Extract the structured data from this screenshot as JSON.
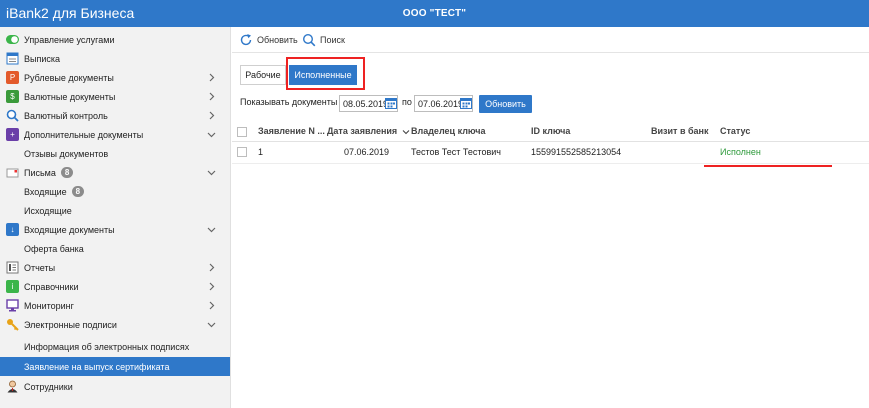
{
  "header": {
    "brand": "iBank2 для Бизнеса",
    "company": "ООО \"ТЕСТ\""
  },
  "colors": {
    "accent": "#2f78c9",
    "highlight": "#ee2222",
    "status_ok": "#2e9a3b"
  },
  "sidebar": {
    "items": [
      {
        "label": "Управление услугами",
        "icon": "toggle-icon"
      },
      {
        "label": "Выписка",
        "icon": "statement-icon"
      },
      {
        "label": "Рублевые документы",
        "icon": "ruble-doc-icon"
      },
      {
        "label": "Валютные документы",
        "icon": "currency-doc-icon"
      },
      {
        "label": "Валютный контроль",
        "icon": "magnifier-icon"
      },
      {
        "label": "Дополнительные документы",
        "icon": "additional-doc-icon"
      },
      {
        "label": "Отзывы документов"
      },
      {
        "label": "Письма",
        "icon": "letter-icon",
        "badge": "8"
      },
      {
        "label": "Входящие",
        "badge": "8"
      },
      {
        "label": "Исходящие"
      },
      {
        "label": "Входящие документы",
        "icon": "incoming-doc-icon"
      },
      {
        "label": "Оферта банка"
      },
      {
        "label": "Отчеты",
        "icon": "report-icon"
      },
      {
        "label": "Справочники",
        "icon": "reference-icon"
      },
      {
        "label": "Мониторинг",
        "icon": "monitor-icon"
      },
      {
        "label": "Электронные подписи",
        "icon": "key-icon"
      },
      {
        "label": "Информация об электронных подписях"
      },
      {
        "label": "Заявление на выпуск сертификата"
      },
      {
        "label": "Сотрудники",
        "icon": "employee-icon"
      }
    ]
  },
  "toolbar": {
    "refresh_label": "Обновить",
    "search_label": "Поиск"
  },
  "tabs": [
    {
      "label": "Рабочие"
    },
    {
      "label": "Исполненные"
    }
  ],
  "filter": {
    "label_from": "Показывать документы с",
    "date_from": "08.05.2019",
    "label_to": "по",
    "date_to": "07.06.2019",
    "button": "Обновить"
  },
  "table": {
    "columns": [
      "Заявление N ...",
      "Дата заявления",
      "Владелец ключа",
      "ID ключа",
      "Визит в банк",
      "Статус"
    ],
    "rows": [
      {
        "number": "1",
        "date": "07.06.2019",
        "owner": "Тестов Тест Тестович",
        "key_id": "155991552585213054",
        "visit": "",
        "status": "Исполнен"
      }
    ]
  }
}
